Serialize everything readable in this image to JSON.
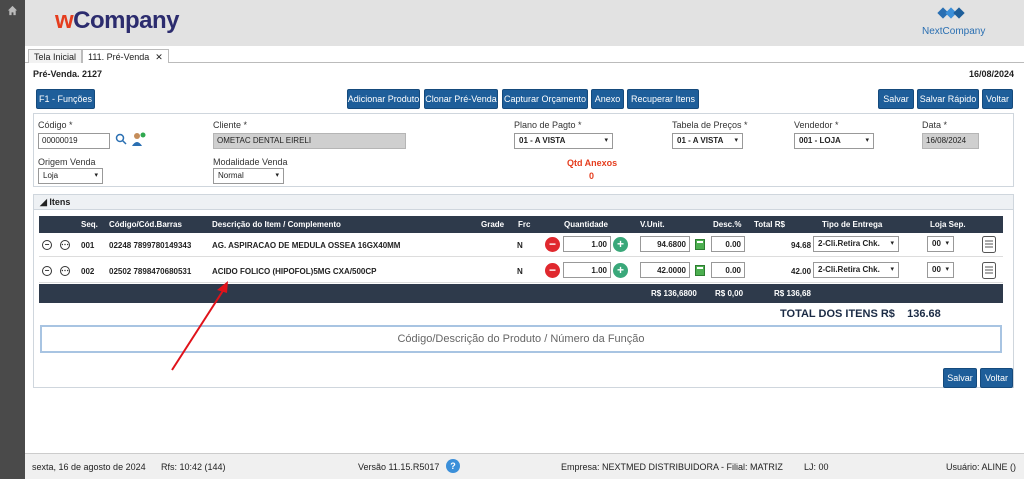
{
  "app": {
    "logo_w": "w",
    "logo_rest": "Company",
    "brand": "NextCompany"
  },
  "tabs": [
    {
      "label": "Tela Inicial"
    },
    {
      "label": "111. Pré-Venda",
      "close": "✕"
    }
  ],
  "page": {
    "title": "Pré-Venda. 2127",
    "date": "16/08/2024"
  },
  "toolbar": {
    "f1": "F1 - Funções",
    "add": "Adicionar Produto",
    "clone": "Clonar Pré-Venda",
    "capture": "Capturar Orçamento",
    "attach": "Anexo",
    "recover": "Recuperar Itens",
    "save": "Salvar",
    "save_fast": "Salvar Rápido",
    "back": "Voltar"
  },
  "form": {
    "codigo_label": "Código *",
    "codigo_value": "00000019",
    "cliente_label": "Cliente *",
    "cliente_value": "OMETAC DENTAL EIRELI",
    "plano_label": "Plano de Pagto *",
    "plano_value": "01 - A VISTA",
    "tabela_label": "Tabela de Preços *",
    "tabela_value": "01 - A VISTA",
    "vendedor_label": "Vendedor *",
    "vendedor_value": "001 - LOJA",
    "data_label": "Data *",
    "data_value": "16/08/2024",
    "origem_label": "Origem Venda",
    "origem_value": "Loja",
    "modalidade_label": "Modalidade Venda",
    "modalidade_value": "Normal",
    "anexos_label": "Qtd Anexos",
    "anexos_value": "0"
  },
  "items": {
    "section_title": "Itens",
    "headers": {
      "seq": "Seq.",
      "codigo": "Código/Cód.Barras",
      "descricao": "Descrição do Item / Complemento",
      "grade": "Grade",
      "frc": "Frc",
      "quantidade": "Quantidade",
      "vunit": "V.Unit.",
      "desc": "Desc.%",
      "total": "Total R$",
      "entrega": "Tipo de Entrega",
      "loja": "Loja Sep."
    },
    "rows": [
      {
        "seq": "001",
        "codigo": "02248 7899780149343",
        "descricao": "AG. ASPIRACAO DE MEDULA OSSEA 16GX40MM",
        "frc": "N",
        "qtd": "1.00",
        "vunit": "94.6800",
        "desc": "0.00",
        "total": "94.68",
        "entrega": "2-Cli.Retira Chk.",
        "loja": "00"
      },
      {
        "seq": "002",
        "codigo": "02502 7898470680531",
        "descricao": "ACIDO FOLICO (HIPOFOL)5MG CXA/500CP",
        "frc": "N",
        "qtd": "1.00",
        "vunit": "42.0000",
        "desc": "0.00",
        "total": "42.00",
        "entrega": "2-Cli.Retira Chk.",
        "loja": "00"
      }
    ],
    "totals": {
      "vunit": "R$ 136,6800",
      "desc": "R$ 0,00",
      "total": "R$ 136,68"
    },
    "grand_label": "TOTAL DOS ITENS R$",
    "grand_value": "136.68",
    "search_placeholder": "Código/Descrição do Produto / Número da Função"
  },
  "bottom": {
    "save": "Salvar",
    "back": "Voltar"
  },
  "status": {
    "date": "sexta, 16 de agosto de 2024",
    "rfs": "Rfs: 10:42 (144)",
    "version": "Versão 11.15.R5017",
    "help": "?",
    "empresa": "Empresa: NEXTMED DISTRIBUIDORA - Filial: MATRIZ",
    "lj": "LJ: 00",
    "usuario": "Usuário: ALINE ()"
  }
}
